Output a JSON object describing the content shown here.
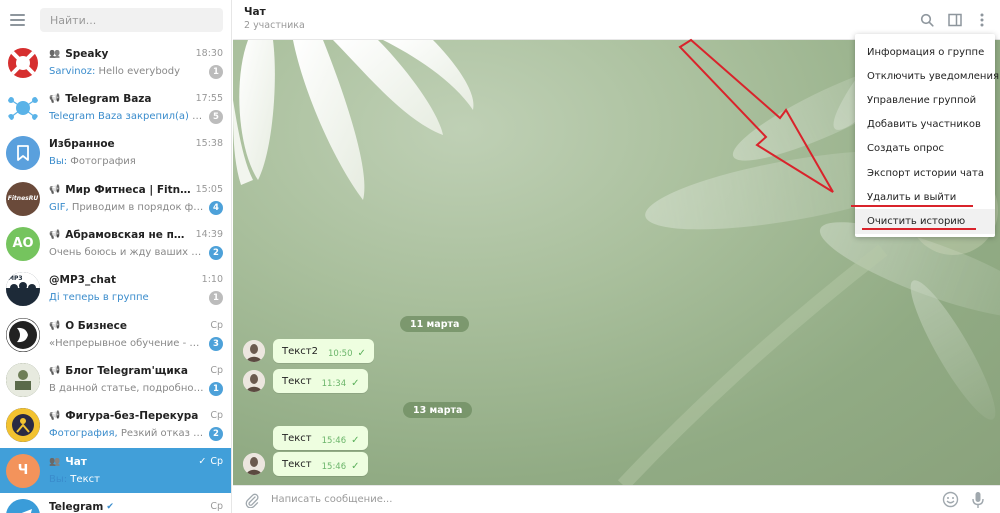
{
  "search": {
    "placeholder": "Найти..."
  },
  "icons": {
    "menu": "hamburger-icon",
    "search": "search-icon",
    "sidebar_toggle": "sidebar-toggle-icon",
    "more": "more-vertical-icon",
    "attach": "paperclip-icon",
    "emoji": "emoji-icon",
    "mic": "microphone-icon",
    "group": "group-icon",
    "channel": "megaphone-icon",
    "read": "double-check-icon",
    "verified": "verified-icon"
  },
  "colors": {
    "accent": "#419fd9",
    "badge_unread": "#4da1d9",
    "badge_muted": "#bcbcbc",
    "bubble": "#eefee0",
    "annotation": "#d9232b"
  },
  "chats": [
    {
      "name": "Speaky",
      "type": "group",
      "time": "18:30",
      "sender": "Sarvinoz:",
      "preview": " Hello everybody",
      "unread": "1",
      "badge": "muted",
      "avatar_color": "#ffffff"
    },
    {
      "name": "Telegram Baza",
      "type": "channel",
      "time": "17:55",
      "sender": "Telegram Baza закрепил(а) «Добр...",
      "preview": "",
      "unread": "5",
      "badge": "muted",
      "avatar_color": "#ffffff"
    },
    {
      "name": "Избранное",
      "type": "",
      "time": "15:38",
      "sender": "Вы:",
      "preview": " Фотография",
      "unread": "",
      "badge": "",
      "avatar_color": "#5aa0dd"
    },
    {
      "name": "Мир Фитнеса | FitnessRU",
      "type": "channel",
      "time": "15:05",
      "sender": "GIF,",
      "preview": " Приводим в порядок фигуру...",
      "unread": "4",
      "badge": "blue",
      "avatar_initials": "FitnesRU",
      "avatar_color": "#6a4a3a"
    },
    {
      "name": "Абрамовская не про обра...",
      "type": "channel",
      "time": "14:39",
      "sender": "",
      "preview": "Очень боюсь и жду ваших совет...",
      "unread": "2",
      "badge": "blue",
      "avatar_initials": "АО",
      "avatar_color": "#75c45e"
    },
    {
      "name": "@MP3_chat",
      "type": "",
      "time": "1:10",
      "sender": "Ді теперь в группе",
      "preview": "",
      "unread": "1",
      "badge": "muted",
      "avatar_color": "#1d2a38"
    },
    {
      "name": "О Бизнесе",
      "type": "channel",
      "time": "Ср",
      "sender": "",
      "preview": "«Непрерывное обучение - мини...",
      "unread": "3",
      "badge": "blue",
      "avatar_color": "#222222"
    },
    {
      "name": "Блог Telegram'щика",
      "type": "channel",
      "time": "Ср",
      "sender": "",
      "preview": "В данной статье, подробно расск...",
      "unread": "1",
      "badge": "blue",
      "avatar_color": "#5a6a4a"
    },
    {
      "name": "Фигура-без-Перекура",
      "type": "channel",
      "time": "Ср",
      "sender": "Фотография,",
      "preview": " Резкий отказ от саха...",
      "unread": "2",
      "badge": "blue",
      "avatar_color": "#2a2a44"
    },
    {
      "name": "Чат",
      "type": "group",
      "time": "Ср",
      "sender": "Вы:",
      "preview": " Текст",
      "unread": "",
      "badge": "",
      "avatar_initials": "Ч",
      "avatar_color": "#f3935b",
      "active": true
    },
    {
      "name": "Telegram",
      "type": "",
      "time": "Ср",
      "sender": "",
      "preview": "",
      "unread": "",
      "badge": "",
      "avatar_color": "#3a9cd9",
      "verified": true
    }
  ],
  "header": {
    "title": "Чат",
    "subtitle": "2 участника"
  },
  "dates": [
    "11 марта",
    "13 марта"
  ],
  "messages": [
    {
      "text": "Текст2",
      "time": "10:50"
    },
    {
      "text": "Текст",
      "time": "11:34"
    },
    {
      "text": "Текст",
      "time": "15:46"
    },
    {
      "text": "Текст",
      "time": "15:46"
    }
  ],
  "menu": [
    "Информация о группе",
    "Отключить уведомления",
    "Управление группой",
    "Добавить участников",
    "Создать опрос",
    "Экспорт истории чата",
    "Удалить и выйти",
    "Очистить историю"
  ],
  "composer": {
    "placeholder": "Написать сообщение..."
  }
}
